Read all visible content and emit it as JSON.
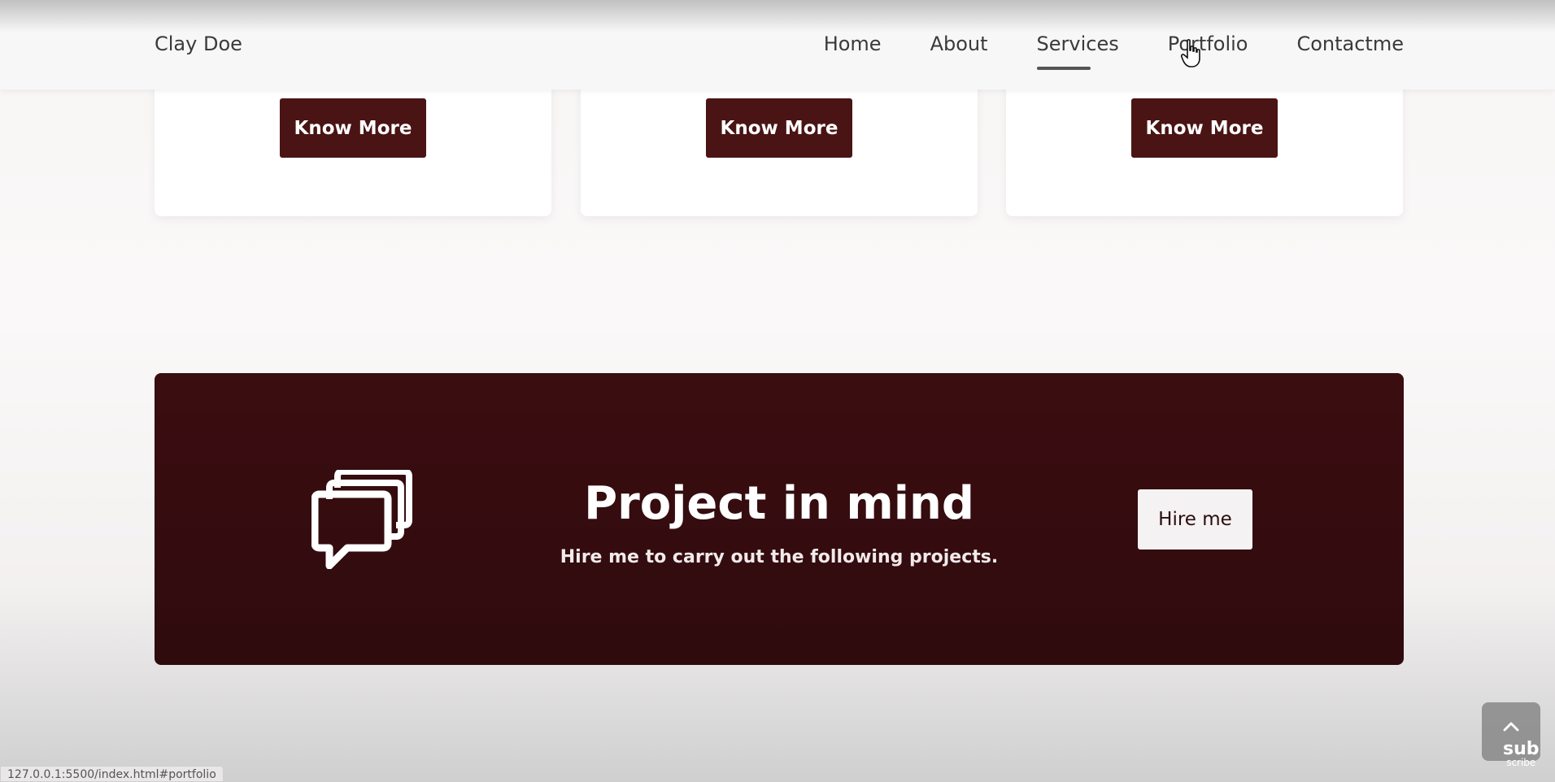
{
  "navbar": {
    "brand": "Clay Doe",
    "links": [
      "Home",
      "About",
      "Services",
      "Portfolio",
      "Contactme"
    ],
    "active": "Services"
  },
  "services": {
    "cards": [
      {
        "button": "Know More"
      },
      {
        "button": "Know More"
      },
      {
        "button": "Know More"
      }
    ]
  },
  "cta": {
    "icon": "chat-bubbles-icon",
    "title": "Project in mind",
    "subtitle": "Hire me to carry out the following projects.",
    "button": "Hire me"
  },
  "status_bar": {
    "url": "127.0.0.1:5500/index.html#portfolio"
  },
  "overlay": {
    "scroll_top_icon": "chevron-up-icon",
    "watermark_main": "sub",
    "watermark_small": "scribe"
  },
  "colors": {
    "accent": "#4a1414",
    "banner": "#350c0f"
  }
}
